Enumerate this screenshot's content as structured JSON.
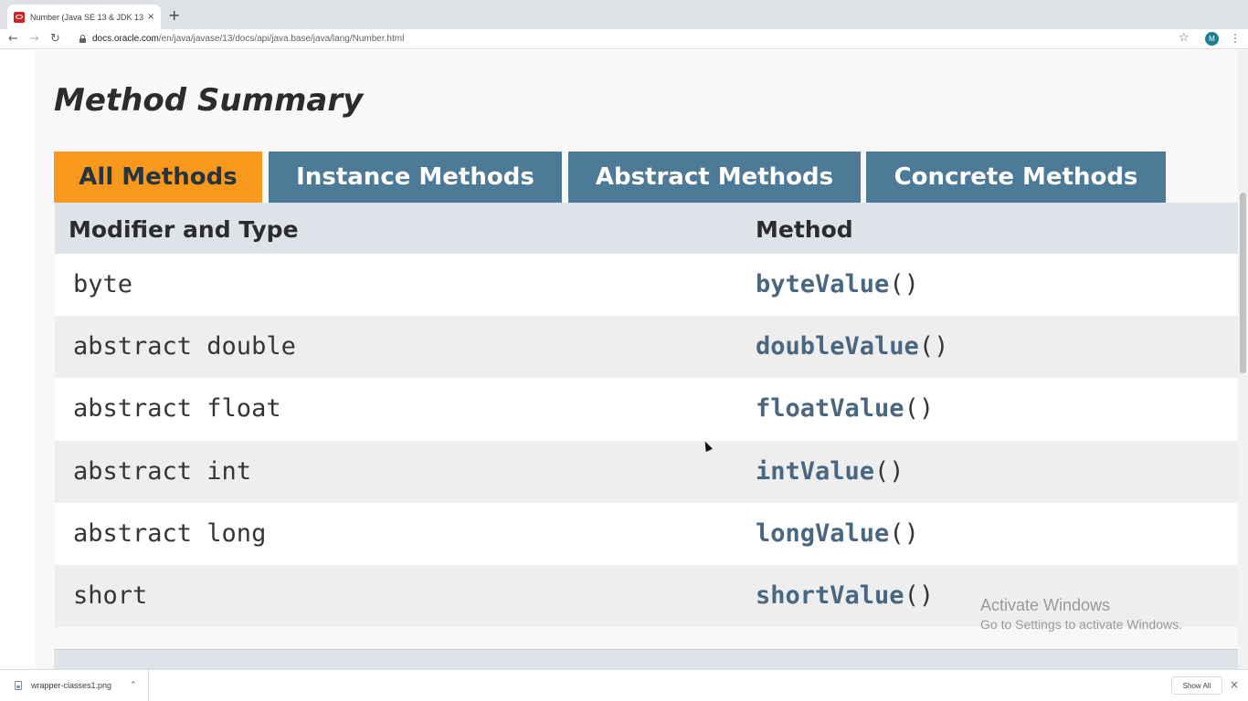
{
  "browser": {
    "tab_title": "Number (Java SE 13 & JDK 13 )",
    "tab_close": "×",
    "new_tab": "+",
    "url_host": "docs.oracle.com",
    "url_path": "/en/java/javase/13/docs/api/java.base/java/lang/Number.html",
    "avatar_initial": "M",
    "back_icon": "arrow-left",
    "forward_icon": "arrow-right",
    "reload_icon": "reload",
    "star_icon": "star",
    "menu_icon": "vertical-dots"
  },
  "page": {
    "heading": "Method Summary",
    "tabs": [
      {
        "label": "All Methods",
        "active": true
      },
      {
        "label": "Instance Methods",
        "active": false
      },
      {
        "label": "Abstract Methods",
        "active": false
      },
      {
        "label": "Concrete Methods",
        "active": false
      }
    ],
    "table": {
      "headers": [
        "Modifier and Type",
        "Method"
      ],
      "rows": [
        {
          "type": "byte",
          "method": "byteValue",
          "parens": "()"
        },
        {
          "type": "abstract double",
          "method": "doubleValue",
          "parens": "()"
        },
        {
          "type": "abstract float",
          "method": "floatValue",
          "parens": "()"
        },
        {
          "type": "abstract int",
          "method": "intValue",
          "parens": "()"
        },
        {
          "type": "abstract long",
          "method": "longValue",
          "parens": "()"
        },
        {
          "type": "short",
          "method": "shortValue",
          "parens": "()"
        }
      ]
    }
  },
  "watermark": {
    "title": "Activate Windows",
    "subtitle": "Go to Settings to activate Windows."
  },
  "downloads": {
    "file_name": "wrapper-classes1.png",
    "show_all": "Show All",
    "close": "×"
  },
  "colors": {
    "active_tab": "#f8981d",
    "inactive_tab": "#4d7a97",
    "header_row": "#dee3e9",
    "method_link": "#4a6782"
  }
}
